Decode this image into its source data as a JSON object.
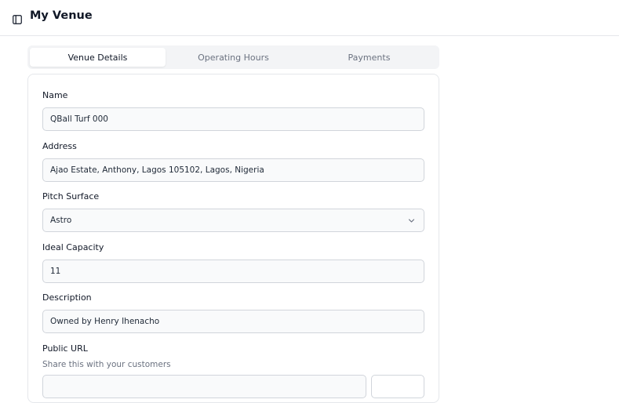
{
  "header": {
    "title": "My Venue",
    "sidebar_toggle_icon": "sidebar-toggle-icon"
  },
  "tabs": [
    {
      "label": "Venue Details",
      "active": true
    },
    {
      "label": "Operating Hours",
      "active": false
    },
    {
      "label": "Payments",
      "active": false
    }
  ],
  "form": {
    "name": {
      "label": "Name",
      "value": "QBall Turf 000"
    },
    "address": {
      "label": "Address",
      "value": "Ajao Estate, Anthony, Lagos 105102, Lagos, Nigeria"
    },
    "pitch_surface": {
      "label": "Pitch Surface",
      "value": "Astro",
      "icon": "chevron-down-icon"
    },
    "ideal_capacity": {
      "label": "Ideal Capacity",
      "value": "11"
    },
    "description": {
      "label": "Description",
      "value": "Owned by Henry Ihenacho"
    },
    "public_url": {
      "label": "Public URL",
      "helper": "Share this with your customers"
    }
  },
  "colors": {
    "border": "#e5e7eb",
    "input_bg": "#f9fafb",
    "tab_bg": "#f3f4f6",
    "muted_text": "#6b7280"
  }
}
